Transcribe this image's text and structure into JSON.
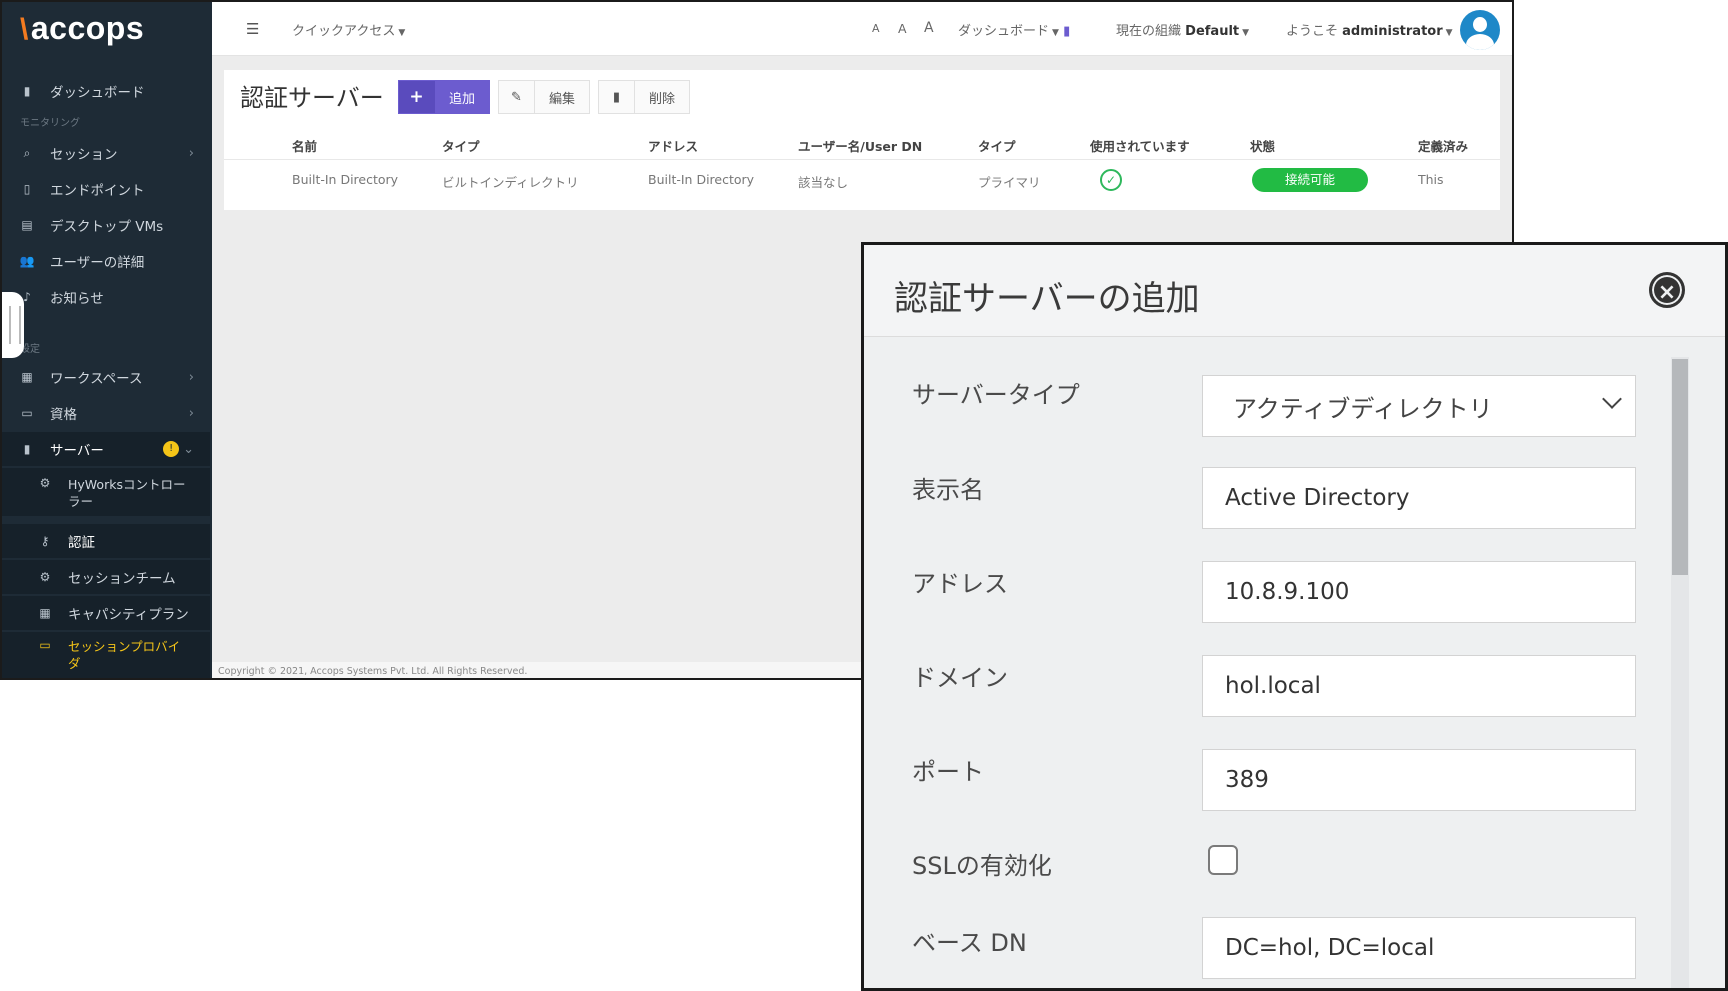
{
  "sidebar": {
    "logo": "accops",
    "items": [
      {
        "label": "ダッシュボード",
        "icon": "bar-chart-icon"
      },
      {
        "section": "モニタリング"
      },
      {
        "label": "セッション",
        "icon": "search-icon",
        "chevron": "›"
      },
      {
        "label": "エンドポイント",
        "icon": "mobile-icon"
      },
      {
        "label": "デスクトップ VMs",
        "icon": "desktop-icon"
      },
      {
        "label": "ユーザーの詳細",
        "icon": "users-icon"
      },
      {
        "label": "お知らせ",
        "icon": "bell-icon"
      },
      {
        "section": "設定"
      },
      {
        "label": "ワークスペース",
        "icon": "grid-icon",
        "chevron": "›"
      },
      {
        "label": "資格",
        "icon": "id-card-icon",
        "chevron": "›"
      },
      {
        "label": "サーバー",
        "icon": "server-icon",
        "badge": "!",
        "chevron": "⌄"
      },
      {
        "label": "HyWorksコントロー",
        "label2": "ラー",
        "icon": "gear-icon"
      },
      {
        "label": "認証",
        "icon": "key-icon"
      },
      {
        "label": "セッションチーム",
        "icon": "gear-icon"
      },
      {
        "label": "キャパシティプラン",
        "icon": "calendar-icon"
      },
      {
        "label": "セッションプロバイ",
        "label2": "ダ",
        "icon": "monitor-icon"
      }
    ]
  },
  "topbar": {
    "quick_access": "クイックアクセス",
    "font_sizes": [
      "A",
      "A",
      "A"
    ],
    "dashboard": "ダッシュボード",
    "org_label": "現在の組織",
    "org_value": "Default",
    "welcome": "ようこそ",
    "username": "administrator"
  },
  "page": {
    "title": "認証サーバー",
    "add_button": "追加",
    "edit_button": "編集",
    "delete_button": "削除"
  },
  "table": {
    "headers": [
      "名前",
      "タイプ",
      "アドレス",
      "ユーザー名/User DN",
      "タイプ",
      "使用されています",
      "状態",
      "定義済み"
    ],
    "row": {
      "name": "Built-In Directory",
      "type": "ビルトインディレクトリ",
      "address": "Built-In Directory",
      "user_dn": "該当なし",
      "type2": "プライマリ",
      "in_use": "✓",
      "status": "接続可能",
      "predefined": "This"
    }
  },
  "footer": {
    "copyright": "Copyright © 2021, Accops Systems Pvt. Ltd. All Rights Reserved."
  },
  "modal": {
    "title": "認証サーバーの追加",
    "fields": {
      "server_type_label": "サーバータイプ",
      "server_type_value": "アクティブディレクトリ",
      "display_name_label": "表示名",
      "display_name_value": "Active Directory",
      "address_label": "アドレス",
      "address_value": "10.8.9.100",
      "domain_label": "ドメイン",
      "domain_value": "hol.local",
      "port_label": "ポート",
      "port_value": "389",
      "ssl_label": "SSLの有効化",
      "ssl_checked": false,
      "base_dn_label": "ベース DN",
      "base_dn_value": "DC=hol, DC=local"
    }
  },
  "colors": {
    "sidebar_bg": "#1e2b36",
    "primary": "#6c5ccf",
    "success": "#22bb44",
    "highlight": "#f5c518"
  }
}
